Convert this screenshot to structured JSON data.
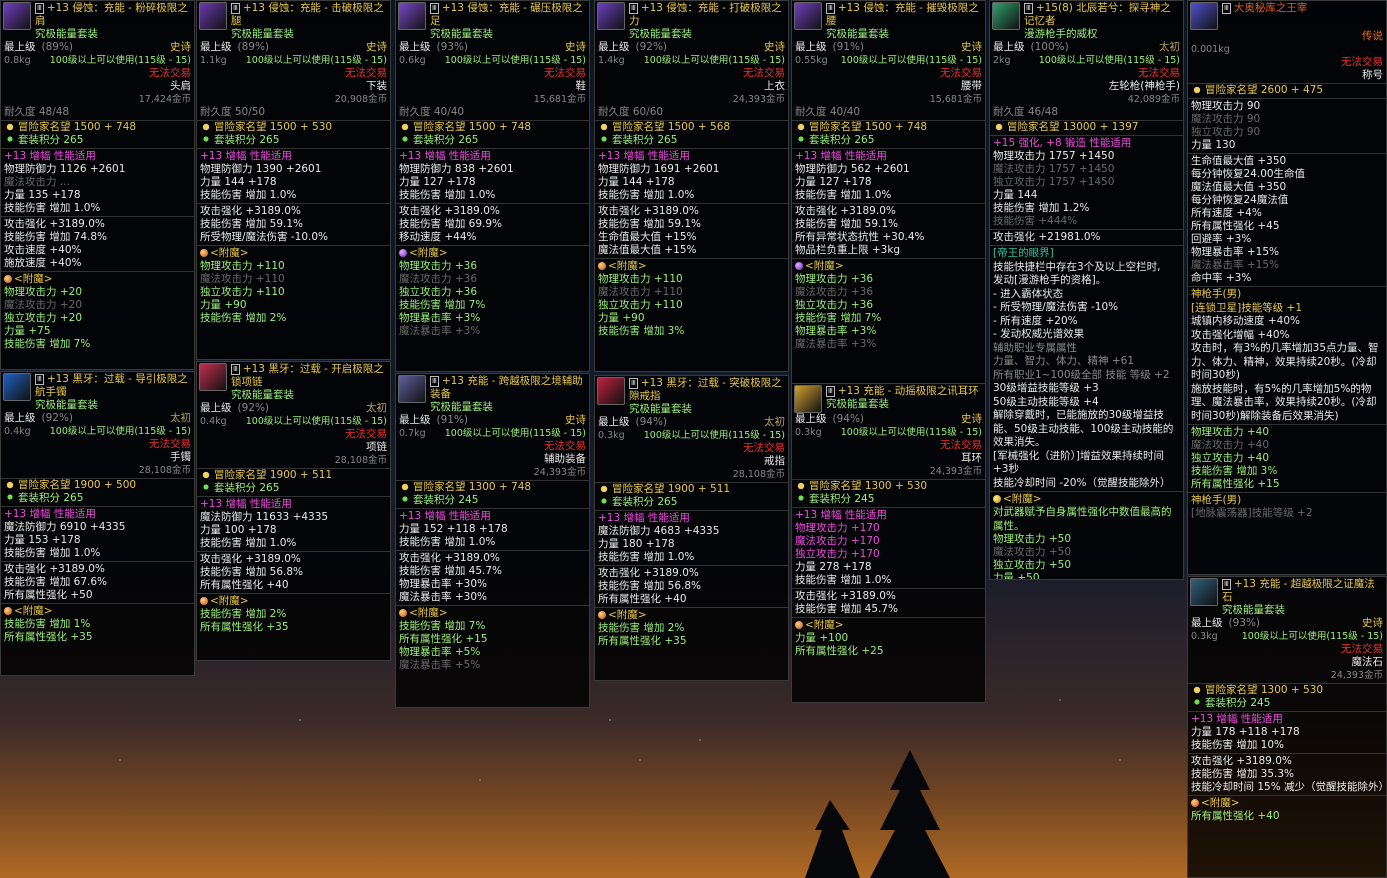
{
  "colors": {
    "legend": "#e8c84a",
    "epic": "#e8c84a",
    "set_green": "#9cf07a",
    "enhance": "#f04ae0",
    "bonus_cyan": "#5ae0f0",
    "untradeable": "#f03030"
  },
  "common": {
    "max_level": "最上级",
    "use_req": "100级以上可以使用(115级 - 15)",
    "no_trade": "无法交易",
    "adventurer_fame": "冒险家名望",
    "set_points": "套装积分",
    "enhance_label": "增幅",
    "perf": "性能适用",
    "enchant": "<附魔>",
    "epic": "史诗",
    "legendary": "传说",
    "taichu": "太初"
  },
  "cards": [
    {
      "title": "+13 侵蚀：充能 - 粉碎极限之肩",
      "set": "究极能量套装",
      "pct": "(89%)",
      "rarity": "史诗",
      "weight": "0.8kg",
      "slot": "头肩",
      "price": "17,424金币",
      "dur": "耐久度 48/48",
      "fame": "冒险家名望 1500 + 748",
      "sp": "套装积分 265",
      "amp": "+13 增幅 性能适用",
      "stats": [
        "物理防御力 1126 +2601",
        "魔法攻击力 ...",
        "力量 135 +178",
        "技能伤害 增加 1.0%"
      ],
      "extra": [
        "攻击强化 +3189.0%",
        "技能伤害 增加 74.8%",
        "攻击速度 +40%",
        "施放速度 +40%"
      ],
      "ench": [
        "物理攻击力 +20",
        "魔法攻击力 +20",
        "独立攻击力 +20",
        "力量 +75",
        "技能伤害 增加 7%"
      ]
    },
    {
      "title": "+13 侵蚀：充能 - 击破极限之腿",
      "set": "究极能量套装",
      "pct": "(89%)",
      "rarity": "史诗",
      "weight": "1.1kg",
      "slot": "下装",
      "price": "20,908金币",
      "dur": "耐久度 50/50",
      "fame": "冒险家名望 1500 + 530",
      "sp": "套装积分 265",
      "amp": "+13 增幅 性能适用",
      "stats": [
        "物理防御力 1390 +2601",
        "力量 144 +178",
        "技能伤害 增加 1.0%"
      ],
      "extra": [
        "攻击强化 +3189.0%",
        "技能伤害 增加 59.1%",
        "所受物理/魔法伤害 -10.0%"
      ],
      "ench": [
        "物理攻击力 +110",
        "魔法攻击力 +110",
        "独立攻击力 +110",
        "力量 +90",
        "技能伤害 增加 2%"
      ]
    },
    {
      "title": "+13 侵蚀：充能 - 碾压极限之足",
      "set": "究极能量套装",
      "pct": "(93%)",
      "rarity": "史诗",
      "weight": "0.6kg",
      "slot": "鞋",
      "price": "15,681金币",
      "dur": "耐久度 40/40",
      "fame": "冒险家名望 1500 + 748",
      "sp": "套装积分 265",
      "amp": "+13 增幅 性能适用",
      "stats": [
        "物理防御力 838 +2601",
        "力量 127 +178",
        "技能伤害 增加 1.0%"
      ],
      "extra": [
        "攻击强化 +3189.0%",
        "技能伤害 增加 69.9%",
        "移动速度 +44%"
      ],
      "ench": [
        "物理攻击力 +36",
        "魔法攻击力 +36",
        "独立攻击力 +36",
        "技能伤害 增加 7%",
        "物理暴击率 +3%",
        "魔法暴击率 +3%"
      ]
    },
    {
      "title": "+13 侵蚀：充能 - 打破极限之力",
      "set": "究极能量套装",
      "pct": "(92%)",
      "rarity": "史诗",
      "weight": "1.4kg",
      "slot": "上衣",
      "price": "24,393金币",
      "dur": "耐久度 60/60",
      "fame": "冒险家名望 1500 + 568",
      "sp": "套装积分 265",
      "amp": "+13 增幅 性能适用",
      "stats": [
        "物理防御力 1691 +2601",
        "力量 144 +178",
        "技能伤害 增加 1.0%"
      ],
      "extra": [
        "攻击强化 +3189.0%",
        "技能伤害 增加 59.1%",
        "生命值最大值 +15%",
        "魔法值最大值 +15%"
      ],
      "ench": [
        "物理攻击力 +110",
        "魔法攻击力 +110",
        "独立攻击力 +110",
        "力量 +90",
        "技能伤害 增加 3%"
      ]
    },
    {
      "title": "+13 侵蚀：充能 - 摧毁极限之腰",
      "set": "究极能量套装",
      "pct": "(91%)",
      "rarity": "史诗",
      "weight": "0.55kg",
      "slot": "腰带",
      "price": "15,681金币",
      "dur": "耐久度 40/40",
      "fame": "冒险家名望 1500 + 748",
      "sp": "套装积分 265",
      "amp": "+13 增幅 性能适用",
      "stats": [
        "物理防御力 562 +2601",
        "力量 127 +178",
        "技能伤害 增加 1.0%"
      ],
      "extra": [
        "攻击强化 +3189.0%",
        "技能伤害 增加 59.1%",
        "所有异常状态抗性 +30.4%",
        "物品栏负重上限 +3kg"
      ],
      "ench": [
        "物理攻击力 +36",
        "魔法攻击力 +36",
        "独立攻击力 +36",
        "技能伤害 增加 7%",
        "物理暴击率 +3%",
        "魔法暴击率 +3%"
      ]
    },
    {
      "title": "+15(8) 北辰若兮：探寻神之记忆者",
      "set": "漫游枪手的威权",
      "pct": "(100%)",
      "rarity": "太初",
      "weight": "2kg",
      "slot": "左轮枪(神枪手)",
      "price": "42,089金币",
      "dur": "耐久度 46/48",
      "fame": "冒险家名望 13000 + 1397",
      "amp": "+15 强化, +8 锻造 性能适用",
      "stats": [
        "物理攻击力 1757 +1450",
        "魔法攻击力 1757 +1450",
        "独立攻击力 1757 +1450",
        "力量 144",
        "技能伤害 增加 1.2%",
        "技能伤害 +444%"
      ],
      "extra": [
        "攻击强化 +21981.0%"
      ],
      "special": [
        "[帝王的眼界]",
        "技能快捷栏中存在3个及以上空栏时,",
        "发动[漫游枪手的资格]。",
        "- 进入霸体状态",
        "- 所受物理/魔法伤害 -10%",
        "- 所有速度 +20%",
        "- 发动权威光谱效果",
        "辅助职业专属属性",
        "力量、智力、体力、精神 +61",
        "所有职业1~100级全部 技能 等级 +2",
        "30级增益技能等级 +3",
        "50级主动技能等级 +4",
        "解除穿戴时，已能施放的30级增益技能、50级主动技能、100级主动技能的效果消失。",
        "[军械强化（进阶）]增益效果持续时间 +3秒",
        "技能冷却时间 -20%（觉醒技能除外）"
      ],
      "ench_title": "<附魔>",
      "ench": [
        "对武器赋予自身属性强化中数值最高的属性。",
        "物理攻击力 +50",
        "魔法攻击力 +50",
        "独立攻击力 +50",
        "力量 +50",
        "所有属性强化 +16"
      ]
    },
    {
      "title": "大奥秘库之王宰",
      "pct": "",
      "rarity": "传说",
      "weight": "0.001kg",
      "slot": "称号",
      "fame": "冒险家名望 2600 + 475",
      "stats": [
        "物理攻击力 90",
        "魔法攻击力 90",
        "独立攻击力 90",
        "力量 130"
      ],
      "extra": [
        "生命值最大值 +350",
        "每分钟恢复24.00生命值",
        "魔法值最大值 +350",
        "每分钟恢复24魔法值",
        "所有速度 +4%",
        "所有属性强化 +45",
        "回避率 +3%",
        "物理暴击率 +15%",
        "魔法暴击率 +15%",
        "命中率 +3%"
      ],
      "special": [
        "神枪手(男)",
        "[连锁卫星]技能等级 +1",
        "城镇内移动速度 +40%",
        "攻击强化增幅 +40%",
        "攻击时，有3%的几率增加35点力量、智力、体力、精神，效果持续20秒。(冷却时间30秒)",
        "施放技能时，有5%的几率增加5%的物理、魔法暴击率，效果持续20秒。(冷却时间30秒)解除装备后效果消失)"
      ],
      "ench": [
        "物理攻击力 +40",
        "魔法攻击力 +40",
        "独立攻击力 +40",
        "技能伤害 增加 3%",
        "所有属性强化 +15"
      ],
      "tail": [
        "神枪手(男)",
        "[地脉震荡器]技能等级 +2"
      ]
    },
    {
      "title": "+13 黑牙：过载 - 导引极限之航手镯",
      "set": "究极能量套装",
      "pct": "(92%)",
      "rarity": "太初",
      "weight": "0.4kg",
      "slot": "手镯",
      "price": "28,108金币",
      "fame": "冒险家名望 1900 + 500",
      "sp": "套装积分 265",
      "amp": "+13 增幅 性能适用",
      "stats": [
        "魔法防御力 6910 +4335",
        "力量 153 +178",
        "技能伤害 增加 1.0%"
      ],
      "extra": [
        "攻击强化 +3189.0%",
        "技能伤害 增加 67.6%",
        "所有属性强化 +50"
      ],
      "ench": [
        "技能伤害 增加 1%",
        "所有属性强化 +35"
      ]
    },
    {
      "title": "+13 黑牙：过载 - 开启极限之锁项链",
      "set": "究极能量套装",
      "pct": "(92%)",
      "rarity": "太初",
      "weight": "0.4kg",
      "slot": "项链",
      "price": "28,108金币",
      "fame": "冒险家名望 1900 + 511",
      "sp": "套装积分 265",
      "amp": "+13 增幅 性能适用",
      "stats": [
        "魔法防御力 11633 +4335",
        "力量 100 +178",
        "技能伤害 增加 1.0%"
      ],
      "extra": [
        "攻击强化 +3189.0%",
        "技能伤害 增加 56.8%",
        "所有属性强化 +40"
      ],
      "ench": [
        "技能伤害 增加 2%",
        "所有属性强化 +35"
      ]
    },
    {
      "title": "+13 充能 - 跨越极限之境辅助装备",
      "set": "究极能量套装",
      "pct": "(91%)",
      "rarity": "史诗",
      "weight": "0.7kg",
      "slot": "辅助装备",
      "price": "24,393金币",
      "fame": "冒险家名望 1300 + 748",
      "sp": "套装积分 245",
      "amp": "+13 增幅 性能适用",
      "stats": [
        "力量 152 +118 +178",
        "技能伤害 增加 1.0%"
      ],
      "extra": [
        "攻击强化 +3189.0%",
        "技能伤害 增加 45.7%",
        "物理暴击率 +30%",
        "魔法暴击率 +30%"
      ],
      "ench": [
        "技能伤害 增加 7%",
        "所有属性强化 +15",
        "物理暴击率 +5%",
        "魔法暴击率 +5%"
      ]
    },
    {
      "title": "+13 黑牙：过载 - 突破极限之隙戒指",
      "set": "究极能量套装",
      "pct": "(94%)",
      "rarity": "太初",
      "weight": "0.3kg",
      "slot": "戒指",
      "price": "28,108金币",
      "fame": "冒险家名望 1900 + 511",
      "sp": "套装积分 265",
      "amp": "+13 增幅 性能适用",
      "stats": [
        "魔法防御力 4683 +4335",
        "力量 180 +178",
        "技能伤害 增加 1.0%"
      ],
      "extra": [
        "攻击强化 +3189.0%",
        "技能伤害 增加 56.8%",
        "所有属性强化 +40"
      ],
      "ench": [
        "技能伤害 增加 2%",
        "所有属性强化 +35"
      ]
    },
    {
      "title": "+13 充能 - 动摇极限之讯耳环",
      "set": "究极能量套装",
      "pct": "(94%)",
      "rarity": "史诗",
      "weight": "0.3kg",
      "slot": "耳环",
      "price": "24,393金币",
      "fame": "冒险家名望 1300 + 530",
      "sp": "套装积分 245",
      "amp": "+13 增幅 性能适用",
      "stats": [
        "物理攻击力 +170",
        "魔法攻击力 +170",
        "独立攻击力 +170",
        "力量 278 +178",
        "技能伤害 增加 1.0%"
      ],
      "extra": [
        "攻击强化 +3189.0%",
        "技能伤害 增加 45.7%"
      ],
      "ench": [
        "力量 +100",
        "所有属性强化 +25"
      ]
    },
    {
      "title": "+13 充能 - 超越极限之证魔法石",
      "set": "究极能量套装",
      "pct": "(93%)",
      "rarity": "史诗",
      "weight": "0.3kg",
      "slot": "魔法石",
      "price": "24,393金币",
      "fame": "冒险家名望 1300 + 530",
      "sp": "套装积分 245",
      "amp": "+13 增幅 性能适用",
      "stats": [
        "力量 178 +118 +178",
        "技能伤害 增加 10%"
      ],
      "extra": [
        "攻击强化 +3189.0%",
        "技能伤害 增加 35.3%",
        "技能冷却时间 15% 减少（觉醒技能除外）"
      ],
      "ench": [
        "所有属性强化 +40"
      ]
    }
  ]
}
